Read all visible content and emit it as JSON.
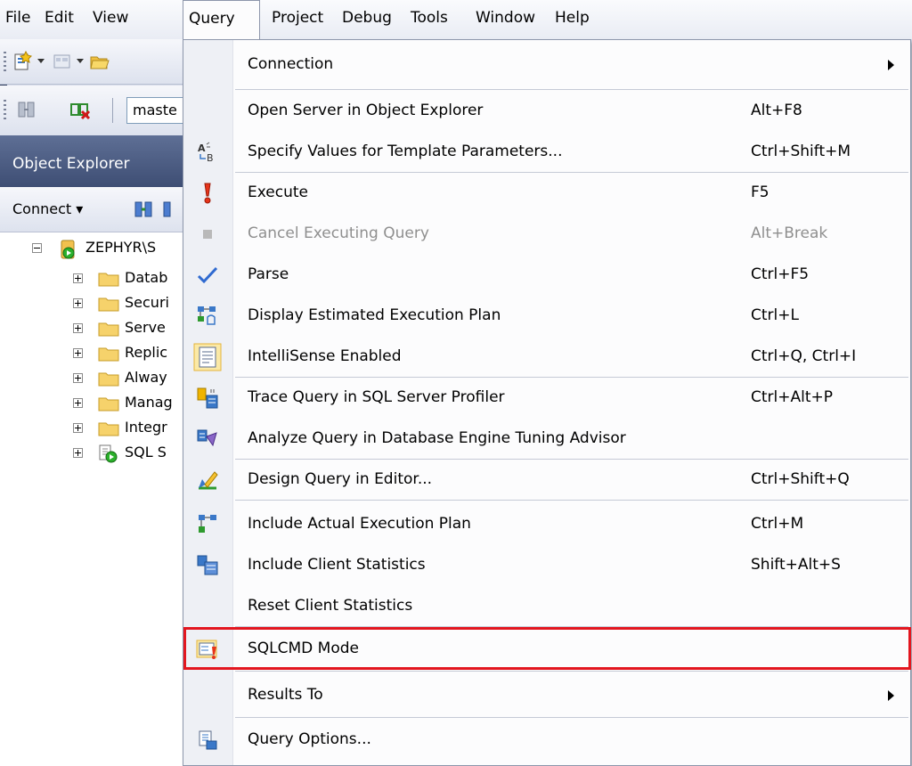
{
  "menubar": {
    "items": [
      "File",
      "Edit",
      "View",
      "Query",
      "Project",
      "Debug",
      "Tools",
      "Window",
      "Help"
    ],
    "open_item": "Query"
  },
  "toolbar2": {
    "database_combo_value": "maste"
  },
  "object_explorer": {
    "title": "Object Explorer",
    "connect_label": "Connect ▾",
    "server_node": "ZEPHYR\\S",
    "tree_items": [
      "Datab",
      "Securi",
      "Serve",
      "Replic",
      "Alway",
      "Manag",
      "Integr",
      "SQL S"
    ]
  },
  "query_menu": {
    "items": [
      {
        "label": "Connection",
        "shortcut": "",
        "submenu": true,
        "icon": "none"
      },
      {
        "label": "Open Server in Object Explorer",
        "shortcut": "Alt+F8",
        "icon": "none"
      },
      {
        "label": "Specify Values for Template Parameters...",
        "shortcut": "Ctrl+Shift+M",
        "icon": "template-parameters-icon"
      },
      {
        "label": "Execute",
        "shortcut": "F5",
        "icon": "execute-icon"
      },
      {
        "label": "Cancel Executing Query",
        "shortcut": "Alt+Break",
        "icon": "stop-icon",
        "disabled": true
      },
      {
        "label": "Parse",
        "shortcut": "Ctrl+F5",
        "icon": "checkmark-icon"
      },
      {
        "label": "Display Estimated Execution Plan",
        "shortcut": "Ctrl+L",
        "icon": "execution-plan-icon"
      },
      {
        "label": "IntelliSense Enabled",
        "shortcut": "Ctrl+Q, Ctrl+I",
        "icon": "intellisense-icon"
      },
      {
        "label": "Trace Query in SQL Server Profiler",
        "shortcut": "Ctrl+Alt+P",
        "icon": "profiler-icon"
      },
      {
        "label": "Analyze Query in Database Engine Tuning Advisor",
        "shortcut": "",
        "icon": "tuning-advisor-icon"
      },
      {
        "label": "Design Query in Editor...",
        "shortcut": "Ctrl+Shift+Q",
        "icon": "design-query-icon"
      },
      {
        "label": "Include Actual Execution Plan",
        "shortcut": "Ctrl+M",
        "icon": "actual-plan-icon"
      },
      {
        "label": "Include Client Statistics",
        "shortcut": "Shift+Alt+S",
        "icon": "client-statistics-icon"
      },
      {
        "label": "Reset Client Statistics",
        "shortcut": "",
        "icon": "none"
      },
      {
        "label": "SQLCMD Mode",
        "shortcut": "",
        "icon": "sqlcmd-icon",
        "highlighted": true
      },
      {
        "label": "Results To",
        "shortcut": "",
        "submenu": true,
        "icon": "none"
      },
      {
        "label": "Query Options...",
        "shortcut": "",
        "icon": "query-options-icon"
      }
    ]
  },
  "colors": {
    "highlight_border": "#e3161f",
    "object_explorer_title": "#4a5a80",
    "disabled_text": "#8f8f8f"
  }
}
